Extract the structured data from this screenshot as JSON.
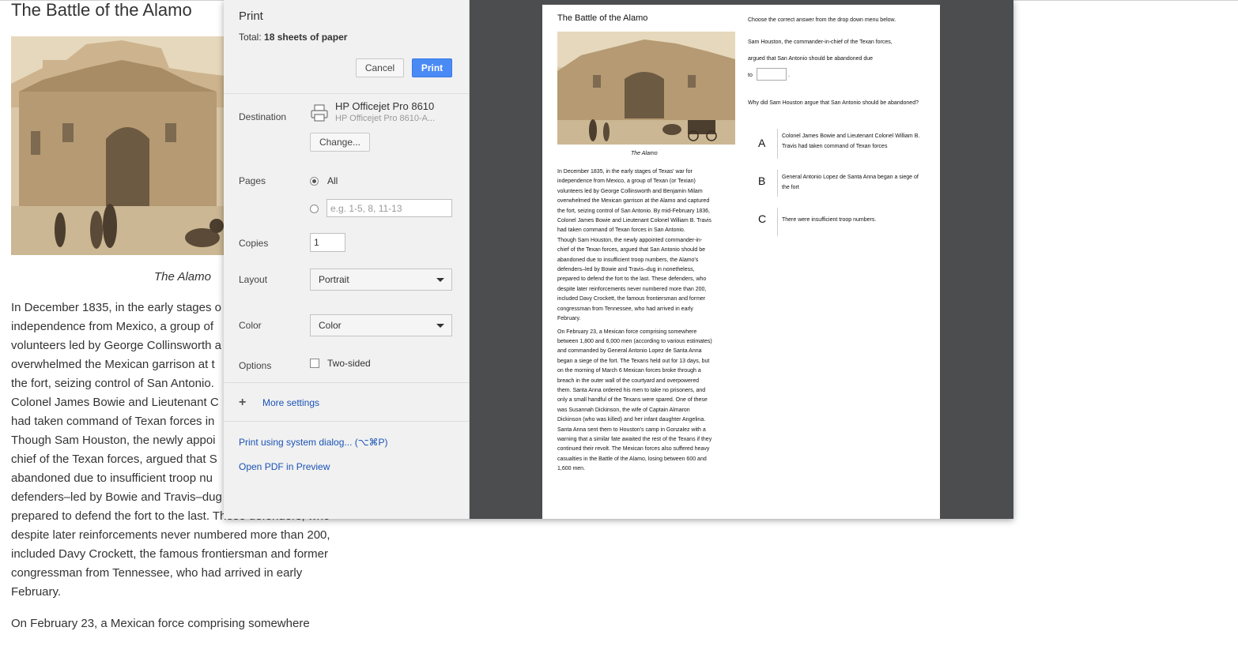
{
  "background_page": {
    "title": "The Battle of the Alamo",
    "caption": "The Alamo",
    "paragraph1_lines": [
      "In December 1835, in the early stages o",
      "independence from Mexico, a group of",
      "volunteers led by George Collinsworth a",
      "overwhelmed the Mexican garrison at t",
      "the fort, seizing control of San Antonio.",
      "Colonel James Bowie and Lieutenant C",
      "had taken command of Texan forces in",
      "Though Sam Houston, the newly appoi",
      "chief of the Texan forces, argued that S",
      "abandoned due to insufficient troop nu",
      "defenders–led by Bowie and Travis–dug",
      "prepared to defend the fort to the last. These defenders, who",
      "despite later reinforcements never numbered more than 200,",
      "included Davy Crockett, the famous frontiersman and former",
      "congressman from Tennessee, who had arrived in early",
      "February."
    ],
    "paragraph2_start": "On February 23, a Mexican force comprising somewhere"
  },
  "dialog": {
    "title": "Print",
    "total_label": "Total:",
    "total_value": "18 sheets of paper",
    "cancel_label": "Cancel",
    "print_label": "Print",
    "destination_label": "Destination",
    "printer_name": "HP Officejet Pro 8610",
    "printer_sub": "HP Officejet Pro 8610-A...",
    "change_label": "Change...",
    "pages_label": "Pages",
    "pages_all_label": "All",
    "pages_range_placeholder": "e.g. 1-5, 8, 11-13",
    "copies_label": "Copies",
    "copies_value": "1",
    "layout_label": "Layout",
    "layout_value": "Portrait",
    "color_label": "Color",
    "color_value": "Color",
    "options_label": "Options",
    "two_sided_label": "Two-sided",
    "more_settings_label": "More settings",
    "system_dialog_label": "Print using system dialog... (⌥⌘P)",
    "open_pdf_label": "Open PDF in Preview"
  },
  "preview": {
    "title": "The Battle of the Alamo",
    "caption": "The Alamo",
    "paragraph1_lines": [
      "In December 1835, in the early stages of Texas' war for",
      "independence from Mexico, a group of Texan (or Texian)",
      "volunteers led by George Collinsworth and Benjamin Milam",
      "overwhelmed the Mexican garrison at the Alamo and captured",
      "the fort, seizing control of San Antonio. By mid-February 1836,",
      "Colonel James Bowie and Lieutenant Colonel William B. Travis",
      "had taken command of Texan forces in San Antonio.",
      "Though Sam Houston, the newly appointed commander-in-",
      "chief of the Texan forces, argued that San Antonio should be",
      "abandoned due to insufficient troop numbers, the Alamo's",
      "defenders–led by Bowie and Travis–dug in nonetheless,",
      "prepared to defend the fort to the last. These defenders, who",
      "despite later reinforcements never numbered more than 200,",
      "included Davy Crockett, the famous frontiersman and former",
      "congressman from Tennessee, who had arrived in early",
      "February."
    ],
    "paragraph2_lines": [
      "On February 23, a Mexican force comprising somewhere",
      "between 1,800 and 6,000 men (according to various estimates)",
      "and commanded by General Antonio Lopez de Santa Anna",
      "began a siege of the fort. The Texans held out for 13 days, but",
      "on the morning of March 6 Mexican forces broke through a",
      "breach in the outer wall of the courtyard and overpowered",
      "them. Santa Anna ordered his men to take no prisoners, and",
      "only a small handful of the Texans were spared. One of these",
      "was Susannah Dickinson, the wife of Captain Almaron",
      "Dickinson (who was killed) and her infant daughter Angelina.",
      "Santa Anna sent them to Houston's camp in Gonzalez with a",
      "warning that a similar fate awaited the rest of the Texans if they",
      "continued their revolt. The Mexican forces also suffered heavy",
      "casualties in the Battle of the Alamo, losing between 600 and",
      "1,600 men."
    ],
    "instruction": "Choose the correct answer from the drop down menu below.",
    "q1_line1": "Sam Houston, the commander-in-chief of the Texan forces,",
    "q1_line2": "argued that San Antonio should be abandoned due",
    "q1_to": "to",
    "q1_end": ".",
    "q2": "Why did Sam Houston argue that San Antonio should be abandoned?",
    "options": [
      {
        "letter": "A",
        "text": "Colonel James Bowie and Lieutenant Colonel William B. Travis had taken command of Texan forces"
      },
      {
        "letter": "B",
        "text": "General Antonio Lopez de Santa Anna began a siege of the fort"
      },
      {
        "letter": "C",
        "text": "There were insufficient troop numbers."
      }
    ]
  },
  "colors": {
    "accent": "#4a8af4",
    "link": "#1a53b6",
    "sidebar_bg": "#f1f1f1",
    "preview_bg": "#4b4d4f"
  },
  "icons": [
    "printer-icon",
    "plus-icon",
    "chevron-down-icon"
  ]
}
